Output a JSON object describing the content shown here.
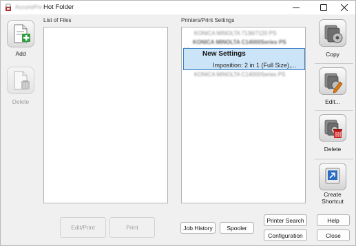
{
  "window": {
    "app_name": "AccurioPro",
    "title": "Hot Folder"
  },
  "left_tools": {
    "add_label": "Add",
    "delete_label": "Delete"
  },
  "files": {
    "label": "List of Files",
    "items": []
  },
  "printers": {
    "label": "Printers/Print Settings",
    "rows": [
      "KONICA MINOLTA 7136/7120 PS",
      "KONICA MINOLTA C14000Series PS",
      "KONICA MINOLTA C14000Series PS"
    ],
    "selected": {
      "name": "New Settings",
      "detail": "Imposition: 2 in 1 (Full Size),..."
    }
  },
  "right_tools": {
    "copy_label": "Copy",
    "edit_label": "Edit...",
    "delete_label": "Delete",
    "shortcut_label_line1": "Create",
    "shortcut_label_line2": "Shortcut"
  },
  "bottom": {
    "edit_print": "Edit/Print",
    "print": "Print",
    "job_history": "Job History",
    "spooler": "Spooler",
    "printer_search": "Printer Search",
    "configuration": "Configuration",
    "help": "Help",
    "close": "Close"
  },
  "colors": {
    "selection_bg": "#cce4f7",
    "selection_border": "#3c82c8",
    "add_plus": "#2e9e3e",
    "delete_trash": "#cc2222",
    "edit_pencil": "#e07a10",
    "shortcut_blue": "#2a6cc4"
  },
  "icons": {
    "app": "app-logo-icon",
    "add": "add-document-icon",
    "delete": "delete-document-icon",
    "copy": "copy-printer-icon",
    "edit": "edit-printer-icon",
    "delete_printer": "delete-printer-icon",
    "shortcut": "create-shortcut-icon"
  }
}
